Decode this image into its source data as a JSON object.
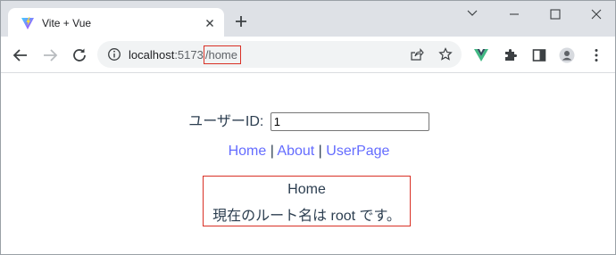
{
  "browser": {
    "tab": {
      "title": "Vite + Vue"
    },
    "address": {
      "host": "localhost",
      "port": ":5173",
      "path": "/home"
    }
  },
  "page": {
    "userid_label": "ユーザーID:",
    "userid_value": "1",
    "nav": {
      "home": "Home",
      "sep1": " | ",
      "about": "About",
      "sep2": " | ",
      "userpage": "UserPage"
    },
    "route_box": {
      "title": "Home",
      "message": "現在のルート名は root です。"
    }
  },
  "colors": {
    "link": "#646cff",
    "highlight_border": "#d93025",
    "text": "#2c3e50"
  },
  "icons": [
    "vite-favicon-icon",
    "close-icon",
    "plus-icon",
    "chevron-down-icon",
    "minimize-icon",
    "maximize-icon",
    "window-close-icon",
    "back-arrow-icon",
    "forward-arrow-icon",
    "reload-icon",
    "info-icon",
    "share-icon",
    "star-icon",
    "vue-devtools-icon",
    "puzzle-icon",
    "side-panel-icon",
    "profile-icon",
    "kebab-menu-icon"
  ]
}
